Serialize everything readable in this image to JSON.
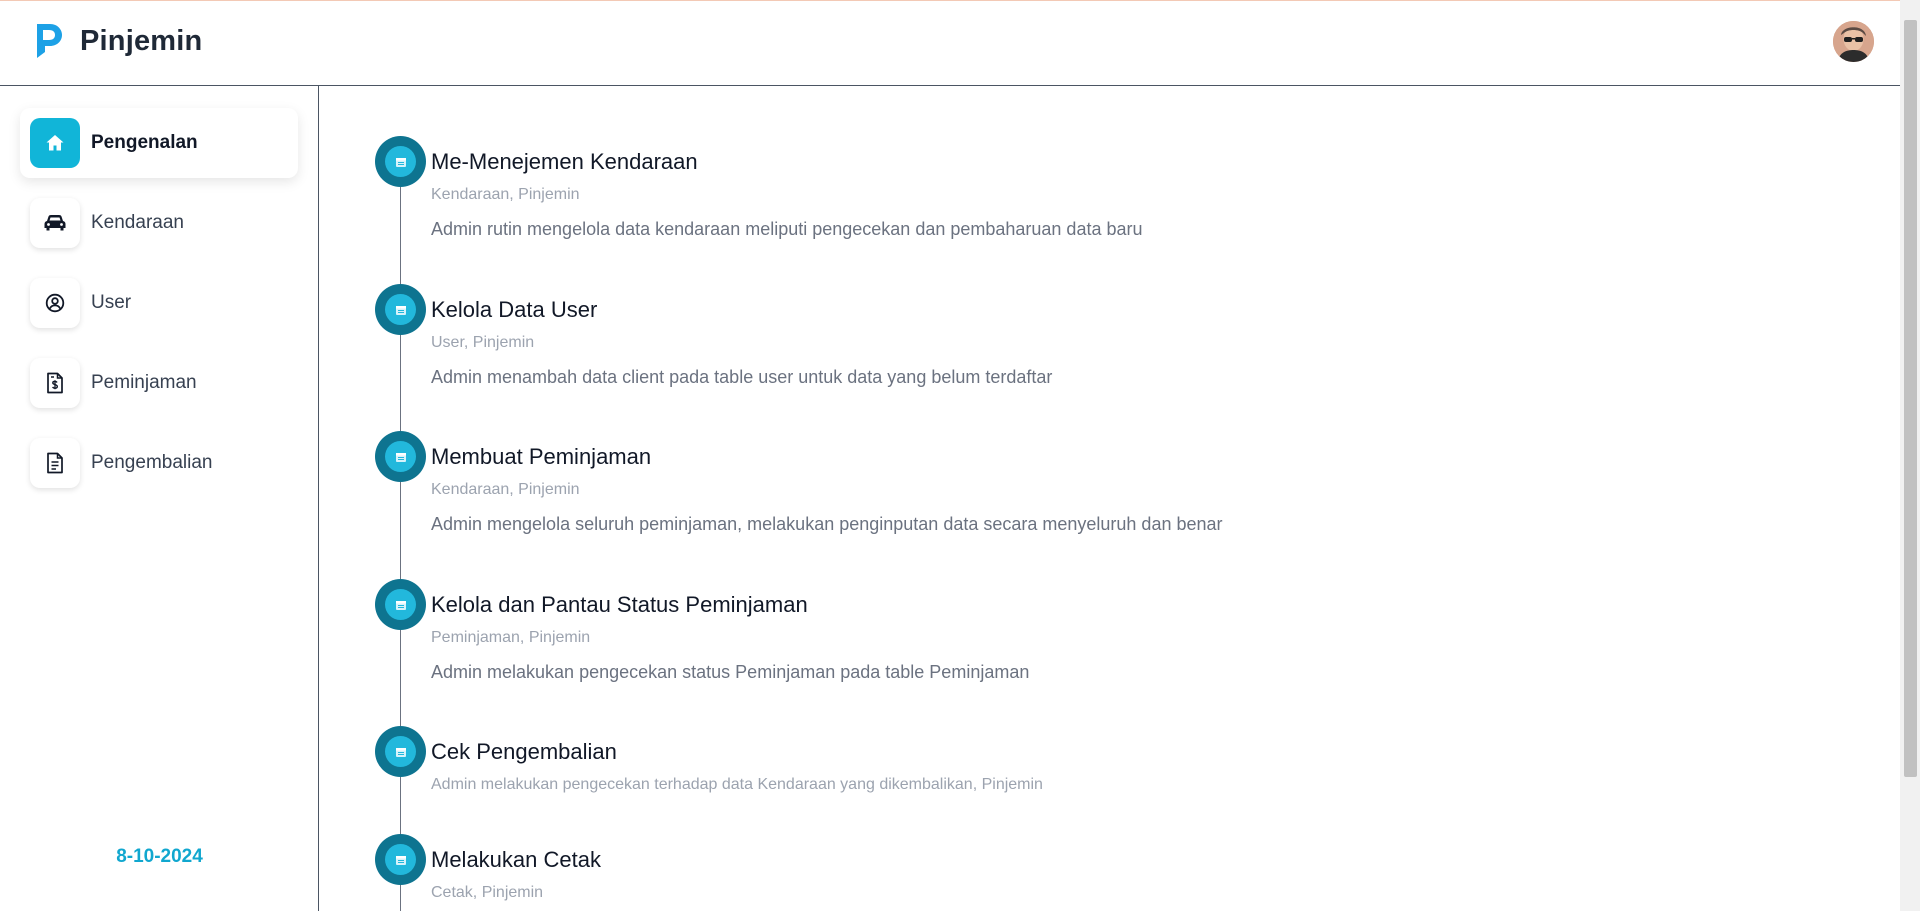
{
  "app": {
    "name": "Pinjemin"
  },
  "sidebar": {
    "items": [
      {
        "label": "Pengenalan",
        "icon": "home-icon",
        "active": true
      },
      {
        "label": "Kendaraan",
        "icon": "car-icon",
        "active": false
      },
      {
        "label": "User",
        "icon": "user-circle-icon",
        "active": false
      },
      {
        "label": "Peminjaman",
        "icon": "document-dollar-icon",
        "active": false
      },
      {
        "label": "Pengembalian",
        "icon": "document-text-icon",
        "active": false
      }
    ],
    "date": "8-10-2024"
  },
  "timeline": [
    {
      "title": "Me-Menejemen Kendaraan",
      "tags": "Kendaraan, Pinjemin",
      "description": "Admin rutin mengelola data kendaraan meliputi pengecekan dan pembaharuan data baru"
    },
    {
      "title": "Kelola Data User",
      "tags": "User, Pinjemin",
      "description": "Admin menambah data client pada table user untuk data yang belum terdaftar"
    },
    {
      "title": "Membuat Peminjaman",
      "tags": "Kendaraan, Pinjemin",
      "description": "Admin mengelola seluruh peminjaman, melakukan penginputan data secara menyeluruh dan benar"
    },
    {
      "title": "Kelola dan Pantau Status Peminjaman",
      "tags": "Peminjaman, Pinjemin",
      "description": "Admin melakukan pengecekan status Peminjaman pada table Peminjaman"
    },
    {
      "title": "Cek Pengembalian",
      "tags": "Admin melakukan pengecekan terhadap data Kendaraan yang dikembalikan, Pinjemin",
      "description": ""
    },
    {
      "title": "Melakukan Cetak",
      "tags": "Cetak, Pinjemin",
      "description": ""
    }
  ],
  "colors": {
    "accent": "#11b5d8",
    "timeline_dot_outer": "#0e7490",
    "date": "#11a7cf"
  }
}
